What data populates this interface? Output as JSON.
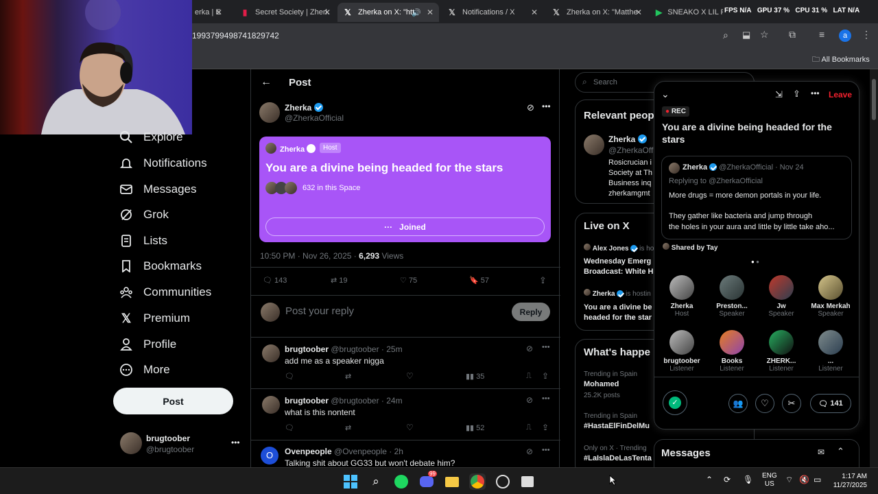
{
  "browser": {
    "tabs": [
      {
        "label": "erka | E",
        "active": false
      },
      {
        "label": "Secret Society | Zherk",
        "active": false
      },
      {
        "label": "Zherka on X: \"htt",
        "active": true
      },
      {
        "label": "Notifications / X",
        "active": false
      },
      {
        "label": "Zherka on X: \"Matthe",
        "active": false
      },
      {
        "label": "SNEAKO X LIL PUMP",
        "active": false
      }
    ],
    "url": "1993799498741829742",
    "all_bookmarks": "All Bookmarks",
    "profile_letter": "a"
  },
  "overlay_stats": {
    "fps_label": "FPS",
    "fps_value": "N/A",
    "gpu_label": "GPU",
    "gpu_value": "37 %",
    "cpu_label": "CPU",
    "cpu_value": "31 %",
    "lat_label": "LAT",
    "lat_value": "N/A"
  },
  "nav": {
    "items": [
      {
        "label": "Explore"
      },
      {
        "label": "Notifications"
      },
      {
        "label": "Messages"
      },
      {
        "label": "Grok"
      },
      {
        "label": "Lists"
      },
      {
        "label": "Bookmarks"
      },
      {
        "label": "Communities"
      },
      {
        "label": "Premium"
      },
      {
        "label": "Profile"
      },
      {
        "label": "More"
      }
    ],
    "post_button": "Post",
    "account_name": "brugtoober",
    "account_handle": "@brugtoober"
  },
  "main": {
    "header_title": "Post",
    "author_name": "Zherka",
    "author_handle": "@ZherkaOfficial",
    "space_card": {
      "host_name": "Zherka",
      "host_badge": "Host",
      "title": "You are a divine being headed for the stars",
      "listeners": "632 in this Space",
      "joined_label": "Joined",
      "color": "#a855f7"
    },
    "timestamp": "10:50 PM · Nov 26, 2025 · ",
    "views_count": "6,293",
    "views_label": " Views",
    "stats": {
      "replies": "143",
      "reposts": "19",
      "likes": "75",
      "bookmarks": "57"
    },
    "reply_placeholder": "Post your reply",
    "reply_button": "Reply",
    "replies": [
      {
        "name": "brugtoober",
        "meta": "@brugtoober · 25m",
        "text": "add me as a speaker nigga",
        "views": "35"
      },
      {
        "name": "brugtoober",
        "meta": "@brugtoober · 24m",
        "text": "what is this nontent",
        "views": "52"
      },
      {
        "name": "Ovenpeople",
        "meta": "@Ovenpeople · 2h",
        "text": "Talking shit about GG33 but won't debate him?"
      }
    ]
  },
  "sidebar": {
    "search_placeholder": "Search",
    "relevant_title": "Relevant peop",
    "relevant_name": "Zherka",
    "relevant_handle": "@ZherkaOffi",
    "relevant_bio": [
      "Rosicrucian i",
      "Society at Th",
      "Business inq",
      "zherkamgmt"
    ],
    "live_title": "Live on X",
    "live_items": [
      {
        "name": "Alex Jones",
        "status": "is ho",
        "title": "Wednesday Emerg",
        "title2": "Broadcast: White H"
      },
      {
        "name": "Zherka",
        "status": "is hostin",
        "title": "You are a divine be",
        "title2": "headed for the star"
      }
    ],
    "happening_title": "What's happe",
    "trends": [
      {
        "meta": "Trending in Spain",
        "name": "Mohamed",
        "count": "25.2K posts"
      },
      {
        "meta": "Trending in Spain",
        "name": "#HastaElFinDelMu"
      },
      {
        "meta": "Only on X · Trending",
        "name": "#LaIslaDeLasTenta"
      }
    ],
    "messages_title": "Messages"
  },
  "space_panel": {
    "rec_label": "REC",
    "leave_label": "Leave",
    "title": "You are a divine being headed for the stars",
    "shared_post": {
      "name": "Zherka",
      "meta": "@ZherkaOfficial · Nov 24",
      "replying": "Replying to @ZherkaOfficial",
      "line1": "More drugs = more demon portals in your life.",
      "line2": "They gather like bacteria and jump through",
      "line3": "the holes in your aura and little by little take aho..."
    },
    "shared_by": "Shared by Tay",
    "speakers": [
      {
        "name": "Zherka",
        "role": "Host"
      },
      {
        "name": "Preston...",
        "role": "Speaker"
      },
      {
        "name": "Jw",
        "role": "Speaker"
      },
      {
        "name": "Max Merkah",
        "role": "Speaker"
      },
      {
        "name": "brugtoober",
        "role": "Listener"
      },
      {
        "name": "Books",
        "role": "Listener"
      },
      {
        "name": "ZHERK...",
        "role": "Listener"
      },
      {
        "name": "...",
        "role": "Listener"
      }
    ],
    "comment_count": "141"
  },
  "taskbar": {
    "lang1": "ENG",
    "lang2": "US",
    "time": "1:17 AM",
    "date": "11/27/2025",
    "discord_badge": "99"
  }
}
